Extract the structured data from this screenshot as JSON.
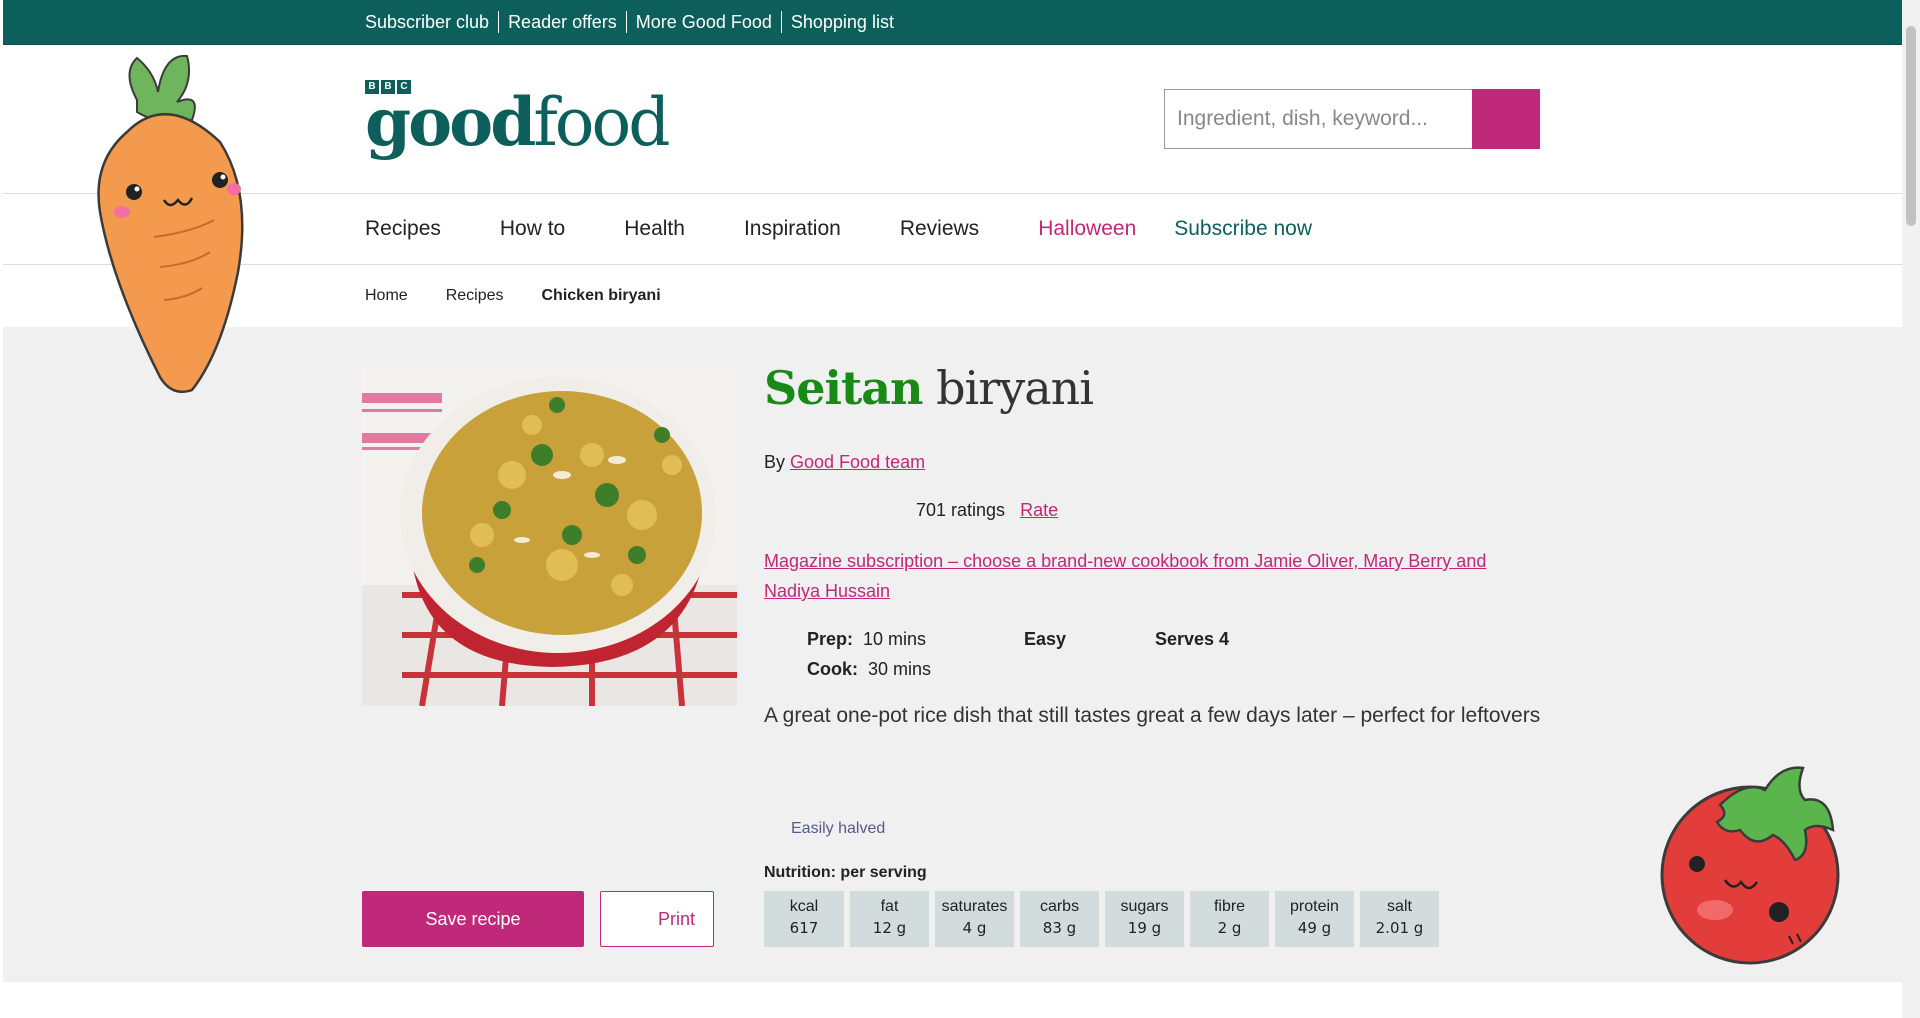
{
  "topbar": {
    "links": [
      "Subscriber club",
      "Reader offers",
      "More Good Food",
      "Shopping list"
    ]
  },
  "header": {
    "logo_bbc": [
      "B",
      "B",
      "C"
    ],
    "logo_bold": "good",
    "logo_light": "food",
    "search_placeholder": "Ingredient, dish, keyword..."
  },
  "nav": {
    "items": [
      "Recipes",
      "How to",
      "Health",
      "Inspiration",
      "Reviews"
    ],
    "halloween": "Halloween",
    "subscribe": "Subscribe now"
  },
  "breadcrumb": {
    "home": "Home",
    "recipes": "Recipes",
    "current": "Chicken biryani"
  },
  "recipe": {
    "title_highlight": "Seitan",
    "title_rest": " biryani",
    "by_prefix": "By ",
    "author": "Good Food team",
    "ratings_count": "701 ratings",
    "rate_label": "Rate",
    "promo_link": "Magazine subscription – choose a brand-new cookbook from Jamie Oliver, Mary Berry and Nadiya Hussain",
    "prep_label": "Prep:",
    "prep_value": "10 mins",
    "cook_label": "Cook:",
    "cook_value": "30 mins",
    "difficulty": "Easy",
    "serves": "Serves 4",
    "description": "A great one-pot rice dish that still tastes great a few days later – perfect for leftovers",
    "badge": "Easily halved"
  },
  "nutrition": {
    "title": "Nutrition: per serving",
    "items": [
      {
        "label": "kcal",
        "value": "617"
      },
      {
        "label": "fat",
        "value": "12 g"
      },
      {
        "label": "saturates",
        "value": "4 g"
      },
      {
        "label": "carbs",
        "value": "83 g"
      },
      {
        "label": "sugars",
        "value": "19 g"
      },
      {
        "label": "fibre",
        "value": "2 g"
      },
      {
        "label": "protein",
        "value": "49 g"
      },
      {
        "label": "salt",
        "value": "2.01 g"
      }
    ]
  },
  "actions": {
    "save_label": "Save recipe",
    "print_label": "Print"
  },
  "colors": {
    "brand_teal": "#0d5f5c",
    "accent_pink": "#c0287a",
    "title_green": "#1a8a16",
    "content_bg": "#f0f0f0",
    "nutrition_bg": "#d3dcdc"
  }
}
